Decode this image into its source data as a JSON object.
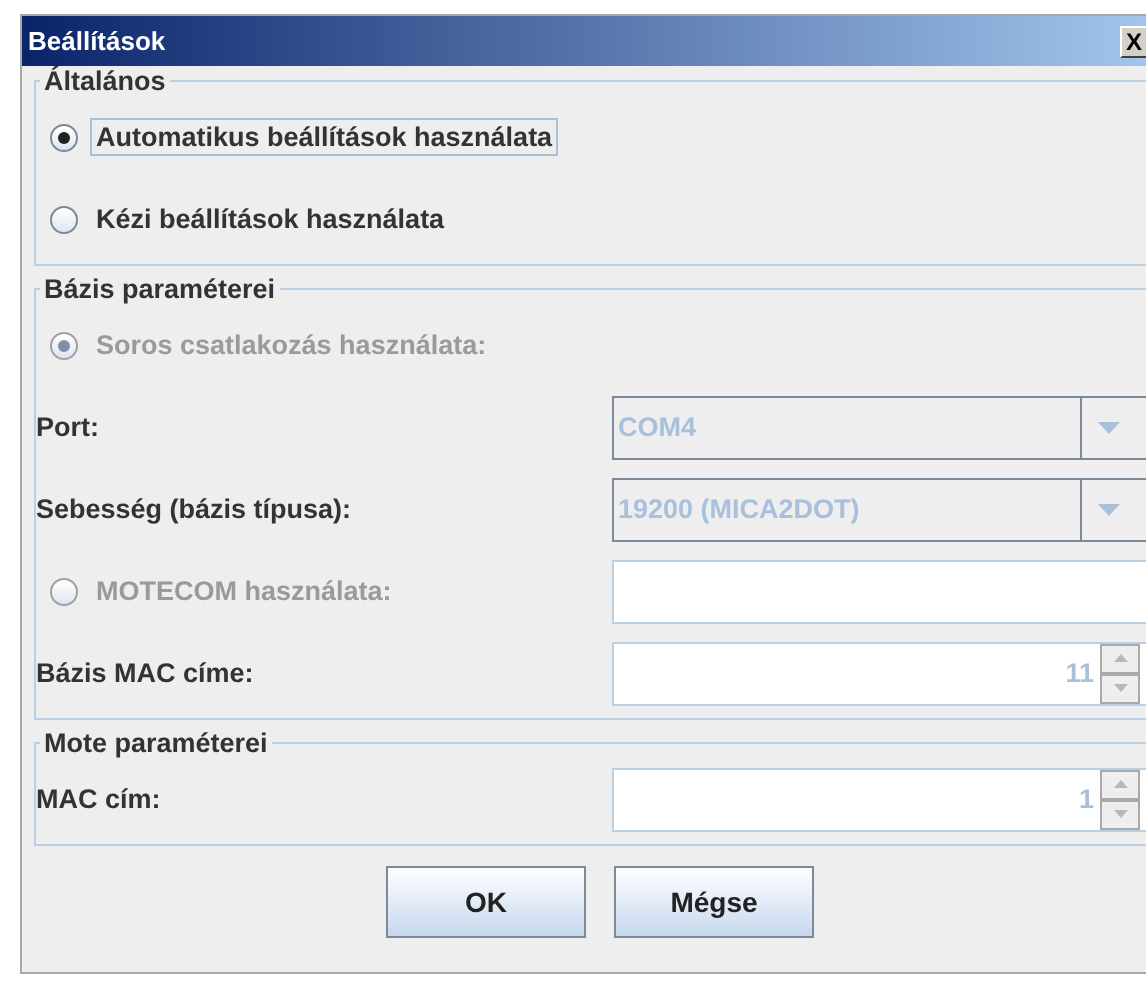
{
  "window": {
    "title": "Beállítások",
    "close": "X"
  },
  "groups": [
    {
      "title": "Általános",
      "rows": [
        {
          "kind": "radio",
          "label": "Automatikus beállítások használata",
          "selected": true,
          "disabled": false,
          "focused": true
        },
        {
          "kind": "radio",
          "label": "Kézi beállítások használata",
          "selected": false,
          "disabled": false,
          "focused": false
        }
      ]
    },
    {
      "title": "Bázis paraméterei",
      "rows": [
        {
          "kind": "radio",
          "label": "Soros csatlakozás használata:",
          "selected": true,
          "disabled": true,
          "focused": false
        },
        {
          "kind": "combo",
          "label": "Port:",
          "value": "COM4",
          "disabled": true
        },
        {
          "kind": "combo",
          "label": "Sebesség (bázis típusa):",
          "value": "19200 (MICA2DOT)",
          "disabled": true
        },
        {
          "kind": "radio-text",
          "label": "MOTECOM használata:",
          "selected": false,
          "disabled": true,
          "value": ""
        },
        {
          "kind": "spinner",
          "label": "Bázis MAC címe:",
          "value": "11",
          "disabled": true
        }
      ]
    },
    {
      "title": "Mote paraméterei",
      "rows": [
        {
          "kind": "spinner",
          "label": "MAC cím:",
          "value": "1",
          "disabled": true
        }
      ]
    }
  ],
  "buttons": [
    "OK",
    "Mégse"
  ]
}
